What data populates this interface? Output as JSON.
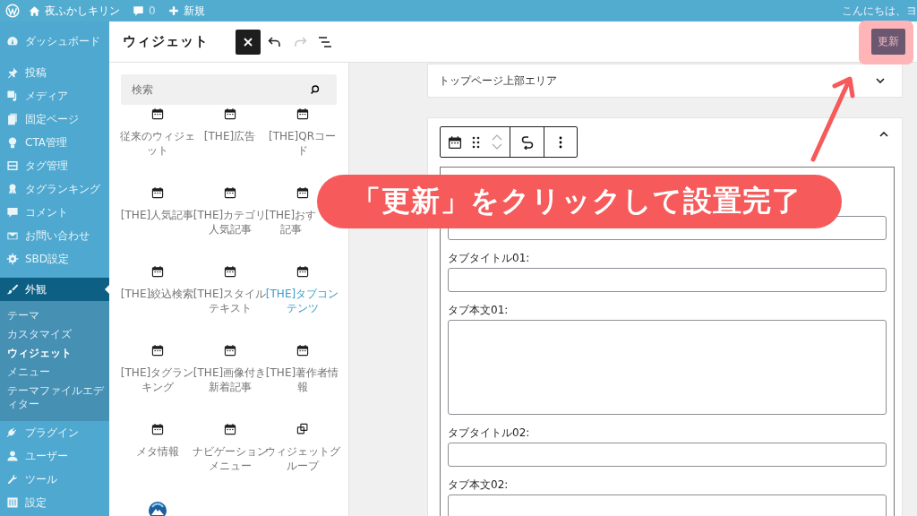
{
  "admin_bar": {
    "site_name": "夜ふかしキリン",
    "comment_count": "0",
    "new_label": "新規",
    "greeting": "こんにちは、ヨ"
  },
  "sidebar": {
    "groups": [
      [
        {
          "label": "ダッシュボード",
          "selected": false
        }
      ],
      [
        {
          "label": "投稿",
          "selected": false
        },
        {
          "label": "メディア",
          "selected": false
        },
        {
          "label": "固定ページ",
          "selected": false
        },
        {
          "label": "CTA管理",
          "selected": false
        },
        {
          "label": "タグ管理",
          "selected": false
        },
        {
          "label": "タグランキング",
          "selected": false
        },
        {
          "label": "コメント",
          "selected": false
        },
        {
          "label": "お問い合わせ",
          "selected": false
        },
        {
          "label": "SBD設定",
          "selected": false
        }
      ],
      [
        {
          "label": "外観",
          "selected": true,
          "children": [
            {
              "label": "テーマ",
              "selected": false
            },
            {
              "label": "カスタマイズ",
              "selected": false
            },
            {
              "label": "ウィジェット",
              "selected": true
            },
            {
              "label": "メニュー",
              "selected": false
            },
            {
              "label": "テーマファイルエディター",
              "selected": false
            }
          ]
        },
        {
          "label": "プラグイン",
          "selected": false
        },
        {
          "label": "ユーザー",
          "selected": false
        },
        {
          "label": "ツール",
          "selected": false
        },
        {
          "label": "設定",
          "selected": false
        }
      ]
    ]
  },
  "header": {
    "title": "ウィジェット",
    "redo_disabled": true,
    "update_button": "更新"
  },
  "inserter": {
    "search_placeholder": "検索",
    "blocks": [
      {
        "kind": "widget",
        "label": "従来のウィジェット",
        "highlighted": false
      },
      {
        "kind": "widget",
        "label": "[THE]広告",
        "highlighted": false
      },
      {
        "kind": "widget",
        "label": "[THE]QRコード",
        "highlighted": false
      },
      {
        "kind": "widget",
        "label": "[THE]人気記事",
        "highlighted": false
      },
      {
        "kind": "widget",
        "label": "[THE]カテゴリ人気記事",
        "highlighted": false
      },
      {
        "kind": "widget",
        "label_lines": [
          "[THE]おす",
          "記事"
        ],
        "highlighted": false
      },
      {
        "kind": "widget",
        "label": "[THE]絞込検索",
        "highlighted": false
      },
      {
        "kind": "widget",
        "label": "[THE]スタイルテキスト",
        "highlighted": false
      },
      {
        "kind": "widget",
        "label": "[THE]タブコンテンツ",
        "highlighted": true
      },
      {
        "kind": "widget",
        "label": "[THE]タグランキング",
        "highlighted": false
      },
      {
        "kind": "widget",
        "label": "[THE]画像付き新着記事",
        "highlighted": false
      },
      {
        "kind": "widget",
        "label": "[THE]著作者情報",
        "highlighted": false
      },
      {
        "kind": "widget",
        "label": "メタ情報",
        "highlighted": false
      },
      {
        "kind": "widget",
        "label": "ナビゲーションメニュー",
        "highlighted": false
      },
      {
        "kind": "group",
        "label": "ウィジェットグループ",
        "highlighted": false
      },
      {
        "kind": "logo"
      }
    ]
  },
  "editor": {
    "areas": [
      {
        "title": "トップページ上部エリア",
        "expanded": false
      },
      {
        "expanded": true,
        "fields": [
          {
            "kind": "input"
          },
          {
            "kind": "input",
            "label": "タブタイトル01:"
          },
          {
            "kind": "textarea",
            "label": "タブ本文01:"
          },
          {
            "kind": "input",
            "label": "タブタイトル02:"
          },
          {
            "kind": "textarea",
            "label": "タブ本文02:"
          }
        ]
      }
    ]
  },
  "annotation": {
    "text": "「更新」をクリックして設置完了"
  }
}
